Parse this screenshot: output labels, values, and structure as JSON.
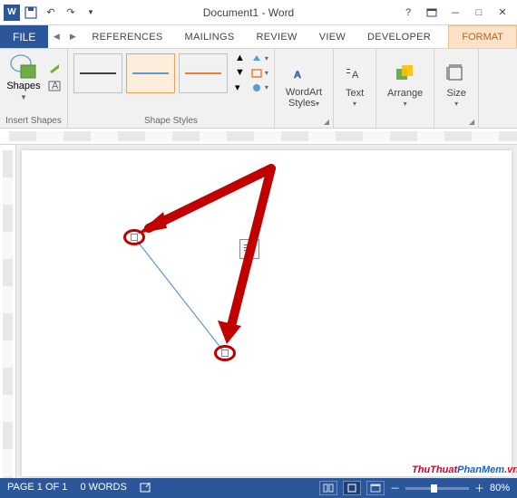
{
  "titlebar": {
    "doc_title": "Document1 - Word"
  },
  "tabs": {
    "file": "FILE",
    "references": "REFERENCES",
    "mailings": "MAILINGS",
    "review": "REVIEW",
    "view": "VIEW",
    "developer": "DEVELOPER",
    "format": "FORMAT"
  },
  "ribbon": {
    "insert_shapes": {
      "shapes": "Shapes",
      "group": "Insert Shapes"
    },
    "shape_styles": {
      "group": "Shape Styles"
    },
    "wordart": {
      "label": "WordArt\nStyles",
      "group": ""
    },
    "text": {
      "label": "Text"
    },
    "arrange": {
      "label": "Arrange"
    },
    "size": {
      "label": "Size"
    }
  },
  "status": {
    "page": "PAGE 1 OF 1",
    "words": "0 WORDS",
    "zoom": "80%"
  },
  "watermark": {
    "part1": "ThuThuat",
    "part2": "PhanMem",
    "part3": ".vn"
  },
  "colors": {
    "accent": "#2b579a",
    "format_tab": "#fce2c7",
    "annotation": "#c00000"
  }
}
